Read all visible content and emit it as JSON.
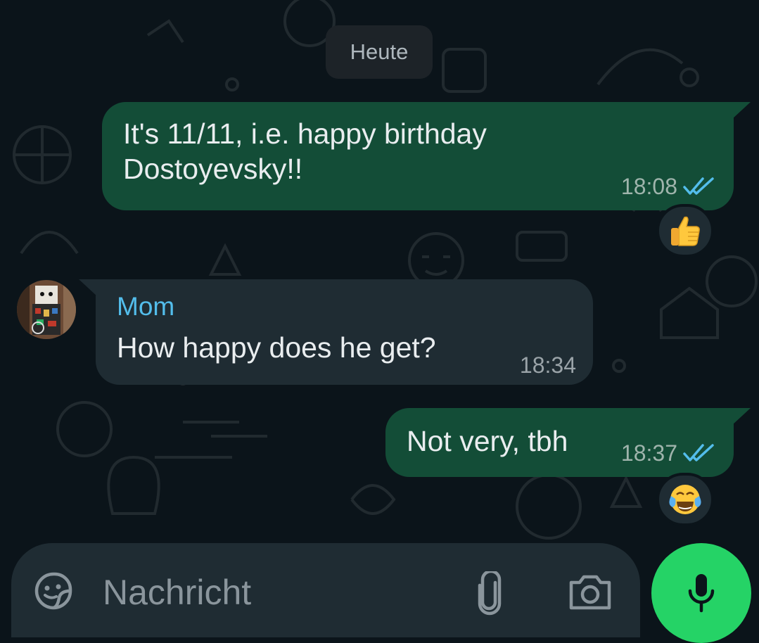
{
  "date_separator": "Heute",
  "messages": [
    {
      "direction": "outgoing",
      "line1": "It's 11/11, i.e. happy birthday",
      "line2": "Dostoyevsky!!",
      "time": "18:08",
      "status": "read",
      "reaction": "thumbs-up"
    },
    {
      "direction": "incoming",
      "sender": "Mom",
      "text": "How happy does he get?",
      "time": "18:34"
    },
    {
      "direction": "outgoing",
      "text": "Not very, tbh",
      "time": "18:37",
      "status": "read",
      "reaction": "tears-of-joy"
    }
  ],
  "composer": {
    "placeholder": "Nachricht",
    "icons": [
      "sticker-icon",
      "attach-icon",
      "camera-icon",
      "mic-icon"
    ]
  },
  "colors": {
    "background": "#0b141a",
    "outgoing_bubble": "#134d37",
    "incoming_bubble": "#1f2c33",
    "sender_name": "#53bdeb",
    "read_ticks": "#53bdeb",
    "mic_button": "#25d366"
  }
}
